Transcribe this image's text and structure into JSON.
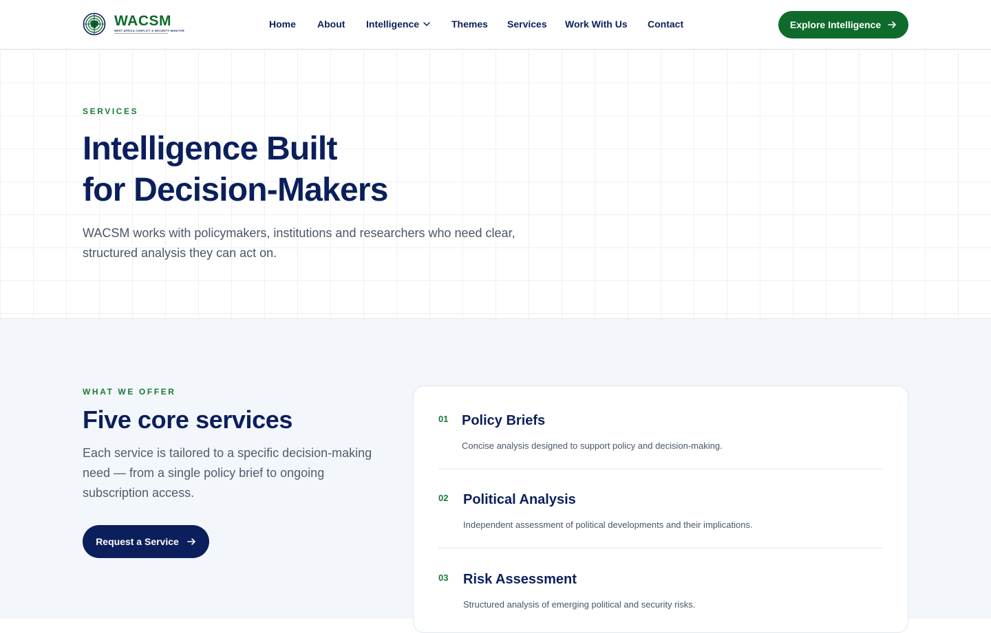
{
  "header": {
    "logo": {
      "brand": "WACSM",
      "tagline": "WEST AFRICA CONFLICT & SECURITY MONITOR"
    },
    "nav": [
      {
        "label": "Home"
      },
      {
        "label": "About"
      },
      {
        "label": "Intelligence",
        "has_dropdown": true
      },
      {
        "label": "Themes"
      },
      {
        "label": "Services"
      },
      {
        "label": "Work With Us"
      },
      {
        "label": "Contact"
      }
    ],
    "cta_label": "Explore Intelligence"
  },
  "hero": {
    "eyebrow": "SERVICES",
    "title_line1": "Intelligence Built",
    "title_line2": "for Decision-Makers",
    "subtitle": "WACSM works with policymakers, institutions and researchers who need clear, structured analysis they can act on."
  },
  "offer": {
    "eyebrow": "WHAT WE OFFER",
    "title": "Five core services",
    "description": "Each service is tailored to a specific decision-making need — from a single policy brief to ongoing subscription access.",
    "button_label": "Request a Service",
    "services": [
      {
        "number": "01",
        "name": "Policy Briefs",
        "description": "Concise analysis designed to support policy and decision-making."
      },
      {
        "number": "02",
        "name": "Political Analysis",
        "description": "Independent assessment of political developments and their implications."
      },
      {
        "number": "03",
        "name": "Risk Assessment",
        "description": "Structured analysis of emerging political and security risks."
      }
    ]
  },
  "colors": {
    "brand_green": "#0e6b2b",
    "navy": "#0b1f5c",
    "section_bg": "#f3f6fb"
  }
}
